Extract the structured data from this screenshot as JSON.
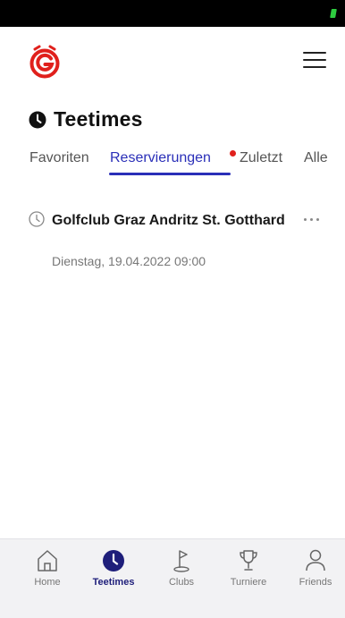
{
  "colors": {
    "accent": "#2a2fb8",
    "brand_red": "#e0201c",
    "nav_active": "#1e1e7a",
    "status_bar": "#000000",
    "battery": "#2ecc40"
  },
  "header": {
    "logo_icon": "golf-timer-logo-icon",
    "menu_icon": "hamburger-menu-icon"
  },
  "page": {
    "title": "Teetimes",
    "title_icon": "clock-filled-icon"
  },
  "tabs": [
    {
      "label": "Favoriten",
      "active": false
    },
    {
      "label": "Reservierungen",
      "active": true,
      "notification": true
    },
    {
      "label": "Zuletzt",
      "active": false
    },
    {
      "label": "Alle",
      "active": false
    }
  ],
  "reservations": [
    {
      "club": "Golfclub Graz Andritz St. Gotthard",
      "datetime": "Dienstag, 19.04.2022 09:00",
      "icon": "clock-outline-icon",
      "more_icon": "more-dots-icon"
    }
  ],
  "bottom_nav": [
    {
      "label": "Home",
      "icon": "home-icon",
      "active": false
    },
    {
      "label": "Teetimes",
      "icon": "clock-filled-icon",
      "active": true
    },
    {
      "label": "Clubs",
      "icon": "golf-flag-icon",
      "active": false
    },
    {
      "label": "Turniere",
      "icon": "trophy-icon",
      "active": false
    },
    {
      "label": "Friends",
      "icon": "person-icon",
      "active": false
    }
  ]
}
